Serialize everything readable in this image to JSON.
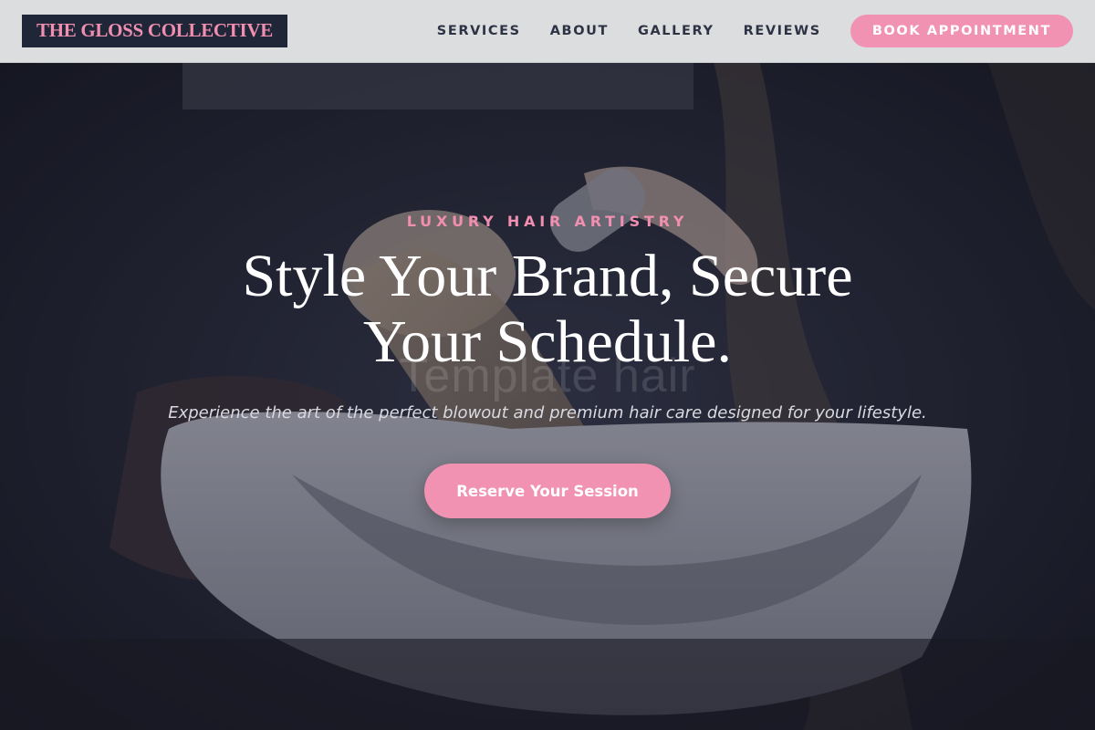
{
  "header": {
    "logo": "THE GLOSS COLLECTIVE",
    "nav": [
      "SERVICES",
      "ABOUT",
      "GALLERY",
      "REVIEWS"
    ],
    "book_button": "BOOK APPOINTMENT"
  },
  "hero": {
    "eyebrow": "LUXURY HAIR ARTISTRY",
    "headline": "Style Your Brand, Secure Your Schedule.",
    "ghost_text": "Template hair",
    "subtext": "Experience the art of the perfect blowout and premium hair care designed for your lifestyle.",
    "cta": "Reserve Your Session"
  },
  "colors": {
    "accent_pink": "#f292b2",
    "logo_bg": "#1f2638",
    "header_bg": "#dcdddf",
    "hero_dark": "#1c1f2c"
  }
}
